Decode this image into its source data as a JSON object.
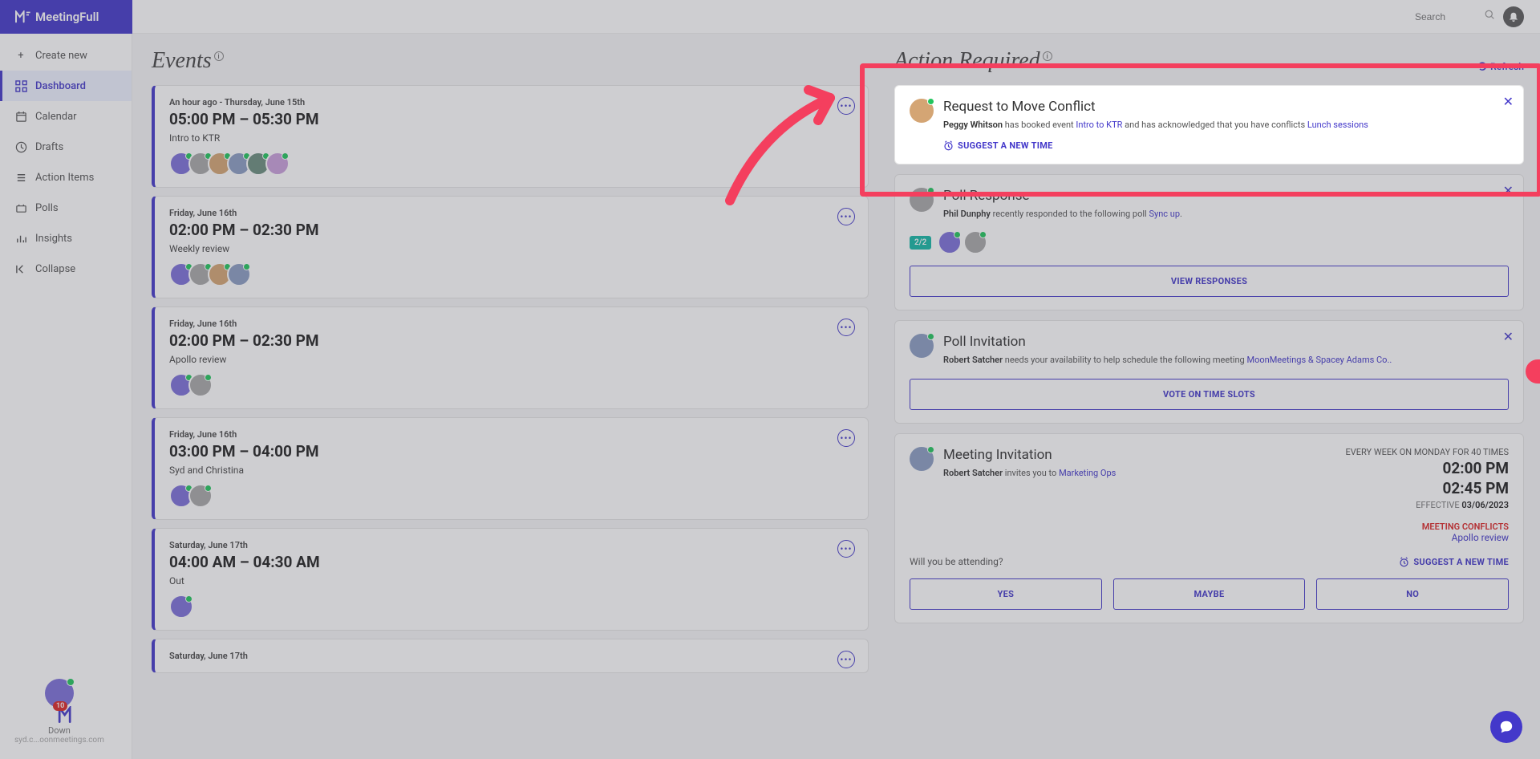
{
  "app": {
    "name": "MeetingFull"
  },
  "header": {
    "search_placeholder": "Search"
  },
  "sidebar": {
    "create": "Create new",
    "items": [
      {
        "label": "Dashboard",
        "active": true
      },
      {
        "label": "Calendar"
      },
      {
        "label": "Drafts"
      },
      {
        "label": "Action Items"
      },
      {
        "label": "Polls"
      },
      {
        "label": "Insights"
      },
      {
        "label": "Collapse"
      }
    ]
  },
  "events": {
    "heading": "Events",
    "items": [
      {
        "date": "An hour ago - Thursday, June 15th",
        "time": "05:00 PM – 05:30 PM",
        "title": "Intro to KTR",
        "avatars": 6
      },
      {
        "date": "Friday, June 16th",
        "time": "02:00 PM – 02:30 PM",
        "title": "Weekly review",
        "avatars": 4
      },
      {
        "date": "Friday, June 16th",
        "time": "02:00 PM – 02:30 PM",
        "title": "Apollo review",
        "avatars": 2
      },
      {
        "date": "Friday, June 16th",
        "time": "03:00 PM – 04:00 PM",
        "title": "Syd and Christina",
        "avatars": 2
      },
      {
        "date": "Saturday, June 17th",
        "time": "04:00 AM – 04:30 AM",
        "title": "Out",
        "avatars": 1
      },
      {
        "date": "Saturday, June 17th",
        "time": "",
        "title": "",
        "avatars": 0
      }
    ]
  },
  "actions": {
    "heading": "Action Required",
    "refresh": "Refresh",
    "conflict": {
      "title": "Request to Move Conflict",
      "person": "Peggy Whitson",
      "desc_mid": " has booked event ",
      "link1": "Intro to KTR",
      "desc_mid2": " and has acknowledged that you have conflicts ",
      "link2": "Lunch sessions",
      "suggest": "SUGGEST A NEW TIME"
    },
    "poll_response": {
      "title": "Poll Response",
      "person": "Phil Dunphy",
      "desc": " recently responded to the following poll ",
      "link": "Sync up",
      "badge": "2/2",
      "button": "VIEW RESPONSES"
    },
    "poll_invitation": {
      "title": "Poll Invitation",
      "person": "Robert Satcher",
      "desc": " needs your availability to help schedule the following meeting ",
      "link": "MoonMeetings & Spacey Adams Co..",
      "button": "VOTE ON TIME SLOTS"
    },
    "meeting_invitation": {
      "title": "Meeting Invitation",
      "person": "Robert Satcher",
      "desc": " invites you to ",
      "link": "Marketing Ops",
      "recurrence": "EVERY WEEK ON MONDAY FOR 40 TIMES",
      "time1": "02:00 PM",
      "time2": "02:45 PM",
      "effective_label": "EFFECTIVE ",
      "effective_date": "03/06/2023",
      "conflicts_label": "MEETING CONFLICTS",
      "conflict_link": "Apollo review",
      "attending": "Will you be attending?",
      "suggest": "SUGGEST A NEW TIME",
      "yes": "YES",
      "maybe": "MAYBE",
      "no": "NO"
    }
  },
  "bottom_user": {
    "name": "Down",
    "email": "syd.c...oonmeetings.com",
    "badge": "10"
  }
}
